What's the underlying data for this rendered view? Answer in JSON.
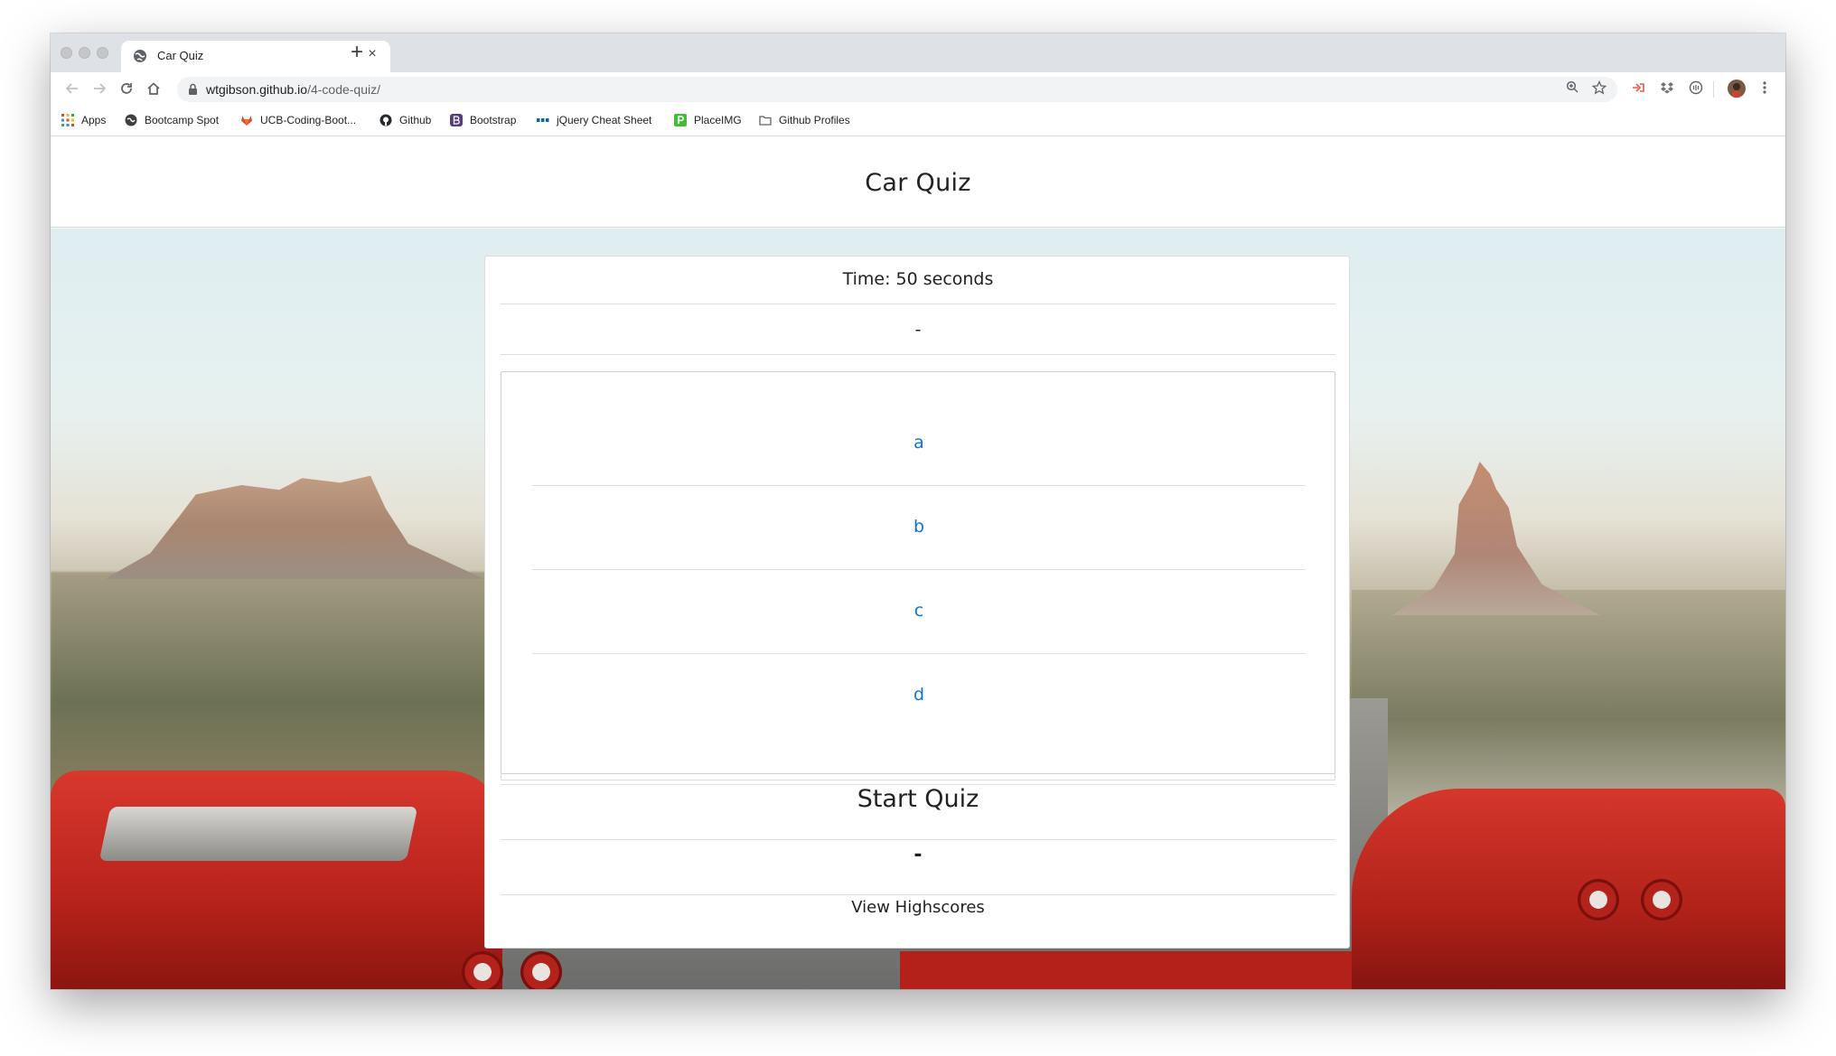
{
  "browser": {
    "tab_title": "Car Quiz",
    "new_tab_symbol": "+",
    "close_symbol": "×",
    "url_host": "wtgibson.github.io",
    "url_path": "/4-code-quiz/"
  },
  "bookmarks": [
    {
      "label": "Apps",
      "icon": "apps-grid-icon"
    },
    {
      "label": "Bootcamp Spot",
      "icon": "bootcamp-icon"
    },
    {
      "label": "UCB-Coding-Boot...",
      "icon": "gitlab-icon"
    },
    {
      "label": "Github",
      "icon": "github-icon"
    },
    {
      "label": "Bootstrap",
      "icon": "bootstrap-icon"
    },
    {
      "label": "jQuery Cheat Sheet",
      "icon": "jquery-icon"
    },
    {
      "label": "PlaceIMG",
      "icon": "placeimg-icon"
    },
    {
      "label": "Github Profiles",
      "icon": "folder-icon"
    }
  ],
  "site": {
    "title": "Car Quiz"
  },
  "quiz": {
    "timer": "Time: 50 seconds",
    "question": "-",
    "answers": [
      "a",
      "b",
      "c",
      "d"
    ],
    "start_label": "Start Quiz",
    "result": "-",
    "highscores_label": "View Highscores"
  },
  "colors": {
    "answer_link": "#0d74d6",
    "accent_red": "#d8382d"
  }
}
